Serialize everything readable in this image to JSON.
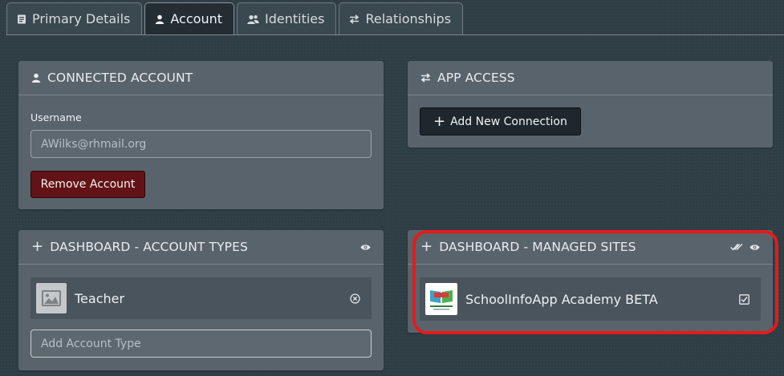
{
  "tabs": [
    {
      "label": "Primary Details",
      "icon": "document-icon",
      "active": false
    },
    {
      "label": "Account",
      "icon": "user-icon",
      "active": true
    },
    {
      "label": "Identities",
      "icon": "users-icon",
      "active": false
    },
    {
      "label": "Relationships",
      "icon": "swap-arrows-icon",
      "active": false
    }
  ],
  "connected_account": {
    "title": "CONNECTED ACCOUNT",
    "username_label": "Username",
    "username_value": "AWilks@rhmail.org",
    "remove_button": "Remove Account"
  },
  "app_access": {
    "title": "APP ACCESS",
    "add_button": "Add New Connection"
  },
  "account_types": {
    "title": "DASHBOARD - ACCOUNT TYPES",
    "items": [
      {
        "label": "Teacher"
      }
    ],
    "add_placeholder": "Add Account Type"
  },
  "managed_sites": {
    "title": "DASHBOARD - MANAGED SITES",
    "items": [
      {
        "label": "SchoolInfoApp Academy BETA"
      }
    ]
  },
  "colors": {
    "background": "#2f3d45",
    "panel": "#59636c",
    "danger_button": "#631317",
    "dark_button": "#1d272d",
    "highlight": "#e41b1b"
  }
}
